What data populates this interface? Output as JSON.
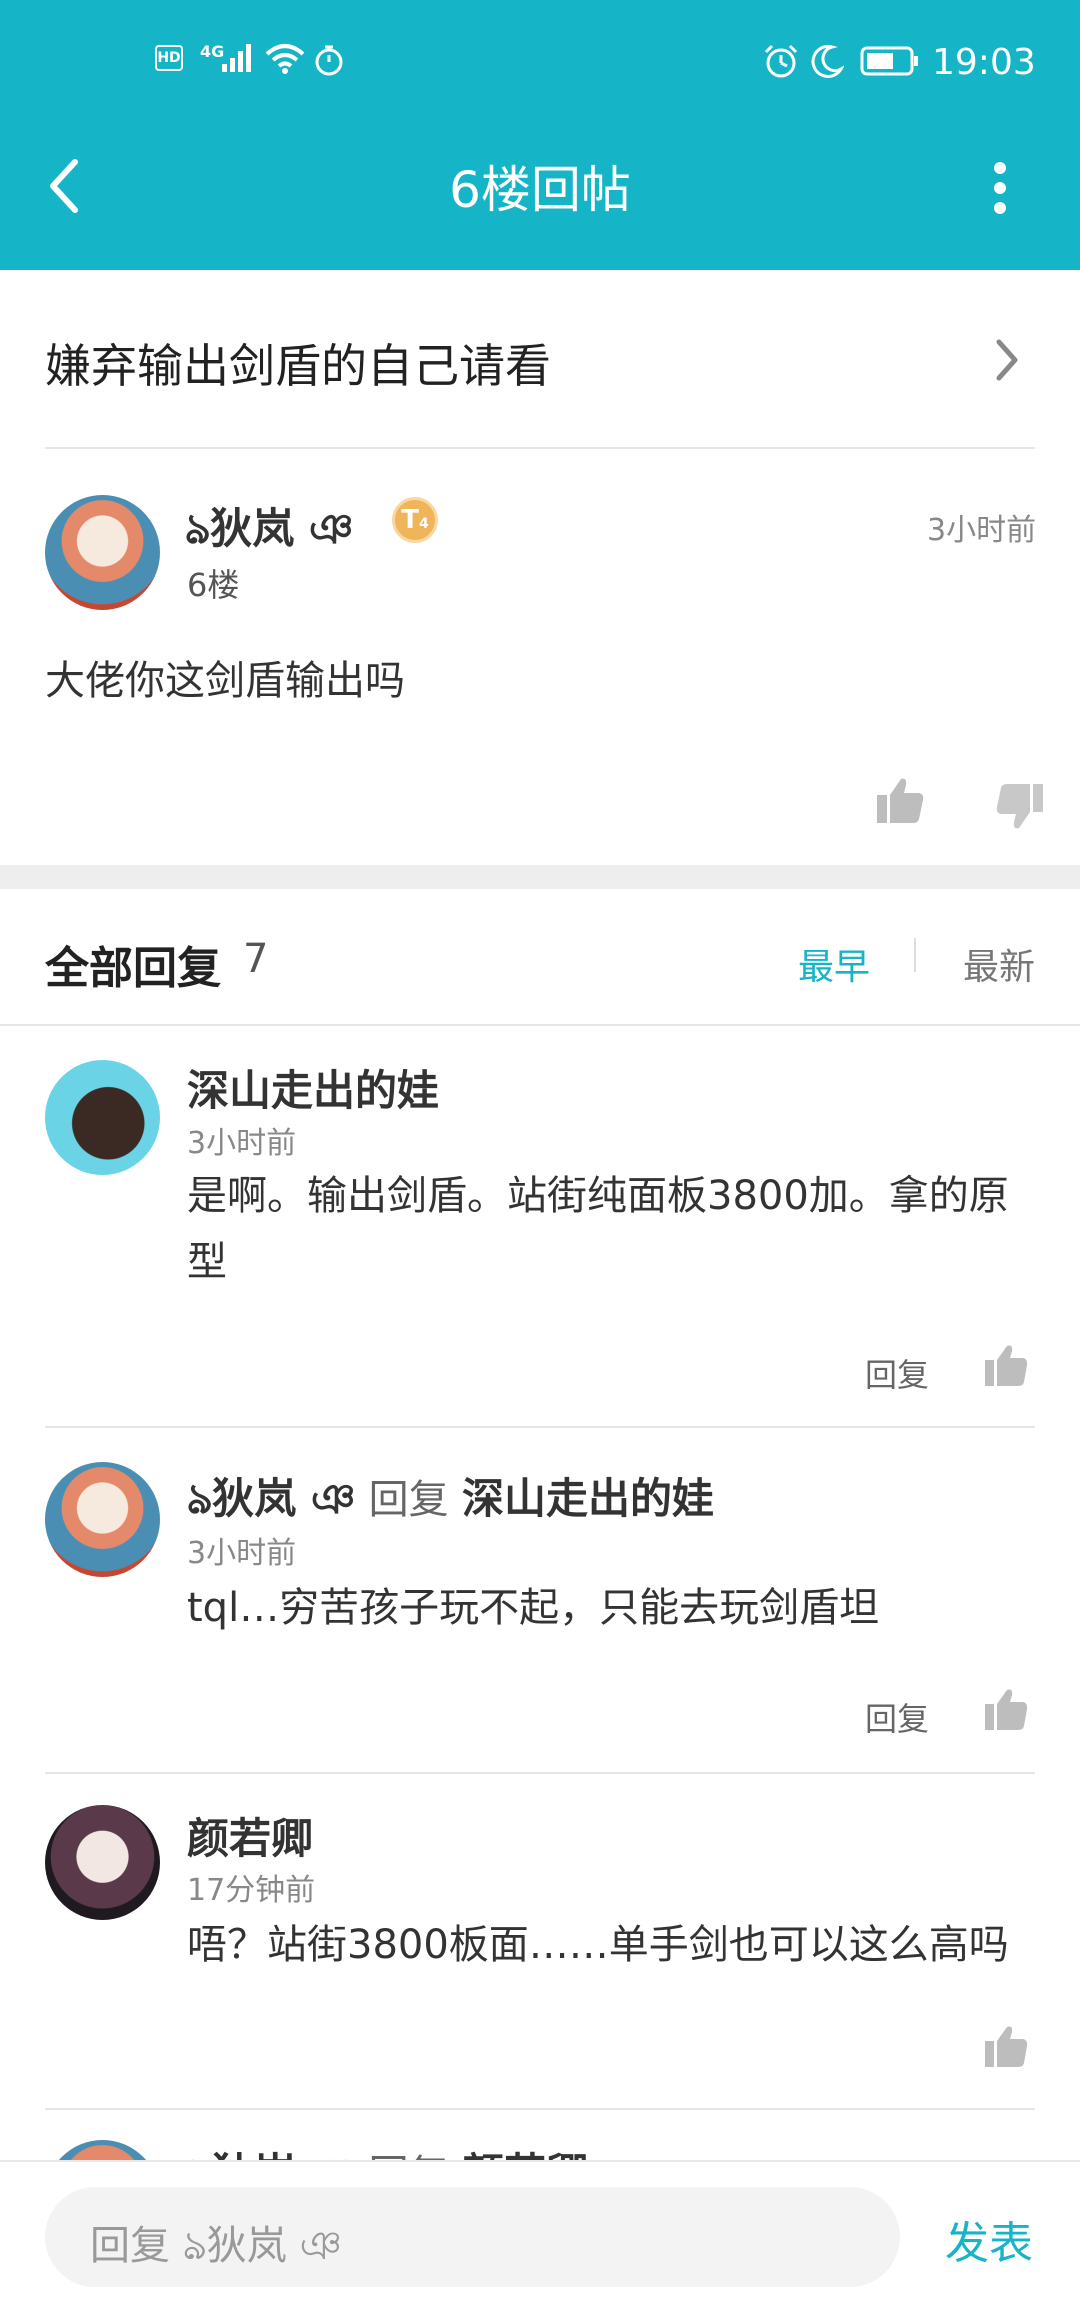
{
  "status_bar": {
    "left_badges": [
      "HD",
      "4G"
    ],
    "time": "19:03"
  },
  "header": {
    "title": "6楼回帖"
  },
  "thread": {
    "title": "嫌弃输出剑盾的自己请看"
  },
  "floor_post": {
    "author": "ঌ狄岚 ঞ",
    "level_badge": "T",
    "level_sub": "4",
    "floor": "6楼",
    "time": "3小时前",
    "content": "大佬你这剑盾输出吗"
  },
  "replies_header": {
    "label": "全部回复",
    "count": "7",
    "sort_earliest": "最早",
    "sort_latest": "最新"
  },
  "replies": [
    {
      "author": "深山走出的娃",
      "time": "3小时前",
      "content": "是啊。输出剑盾。站街纯面板3800加。拿的原型",
      "reply_label": "回复"
    },
    {
      "author": "ঌ狄岚 ঞ",
      "reply_to_word": "回复",
      "reply_to": "深山走出的娃",
      "time": "3小时前",
      "content": "tql…穷苦孩子玩不起，只能去玩剑盾坦",
      "reply_label": "回复"
    },
    {
      "author": "颜若卿",
      "time": "17分钟前",
      "content": "唔？站街3800板面……单手剑也可以这么高吗"
    },
    {
      "author": "ঌ狄岚 ঞ",
      "reply_to_word": "回复",
      "reply_to": "颜若卿"
    }
  ],
  "bottom": {
    "input_placeholder": "回复 ঌ狄岚 ঞ",
    "send_label": "发表"
  },
  "colors": {
    "accent": "#15b5c7",
    "header_bg": "#15b5c7",
    "badge_gold": "#f0b45a"
  }
}
